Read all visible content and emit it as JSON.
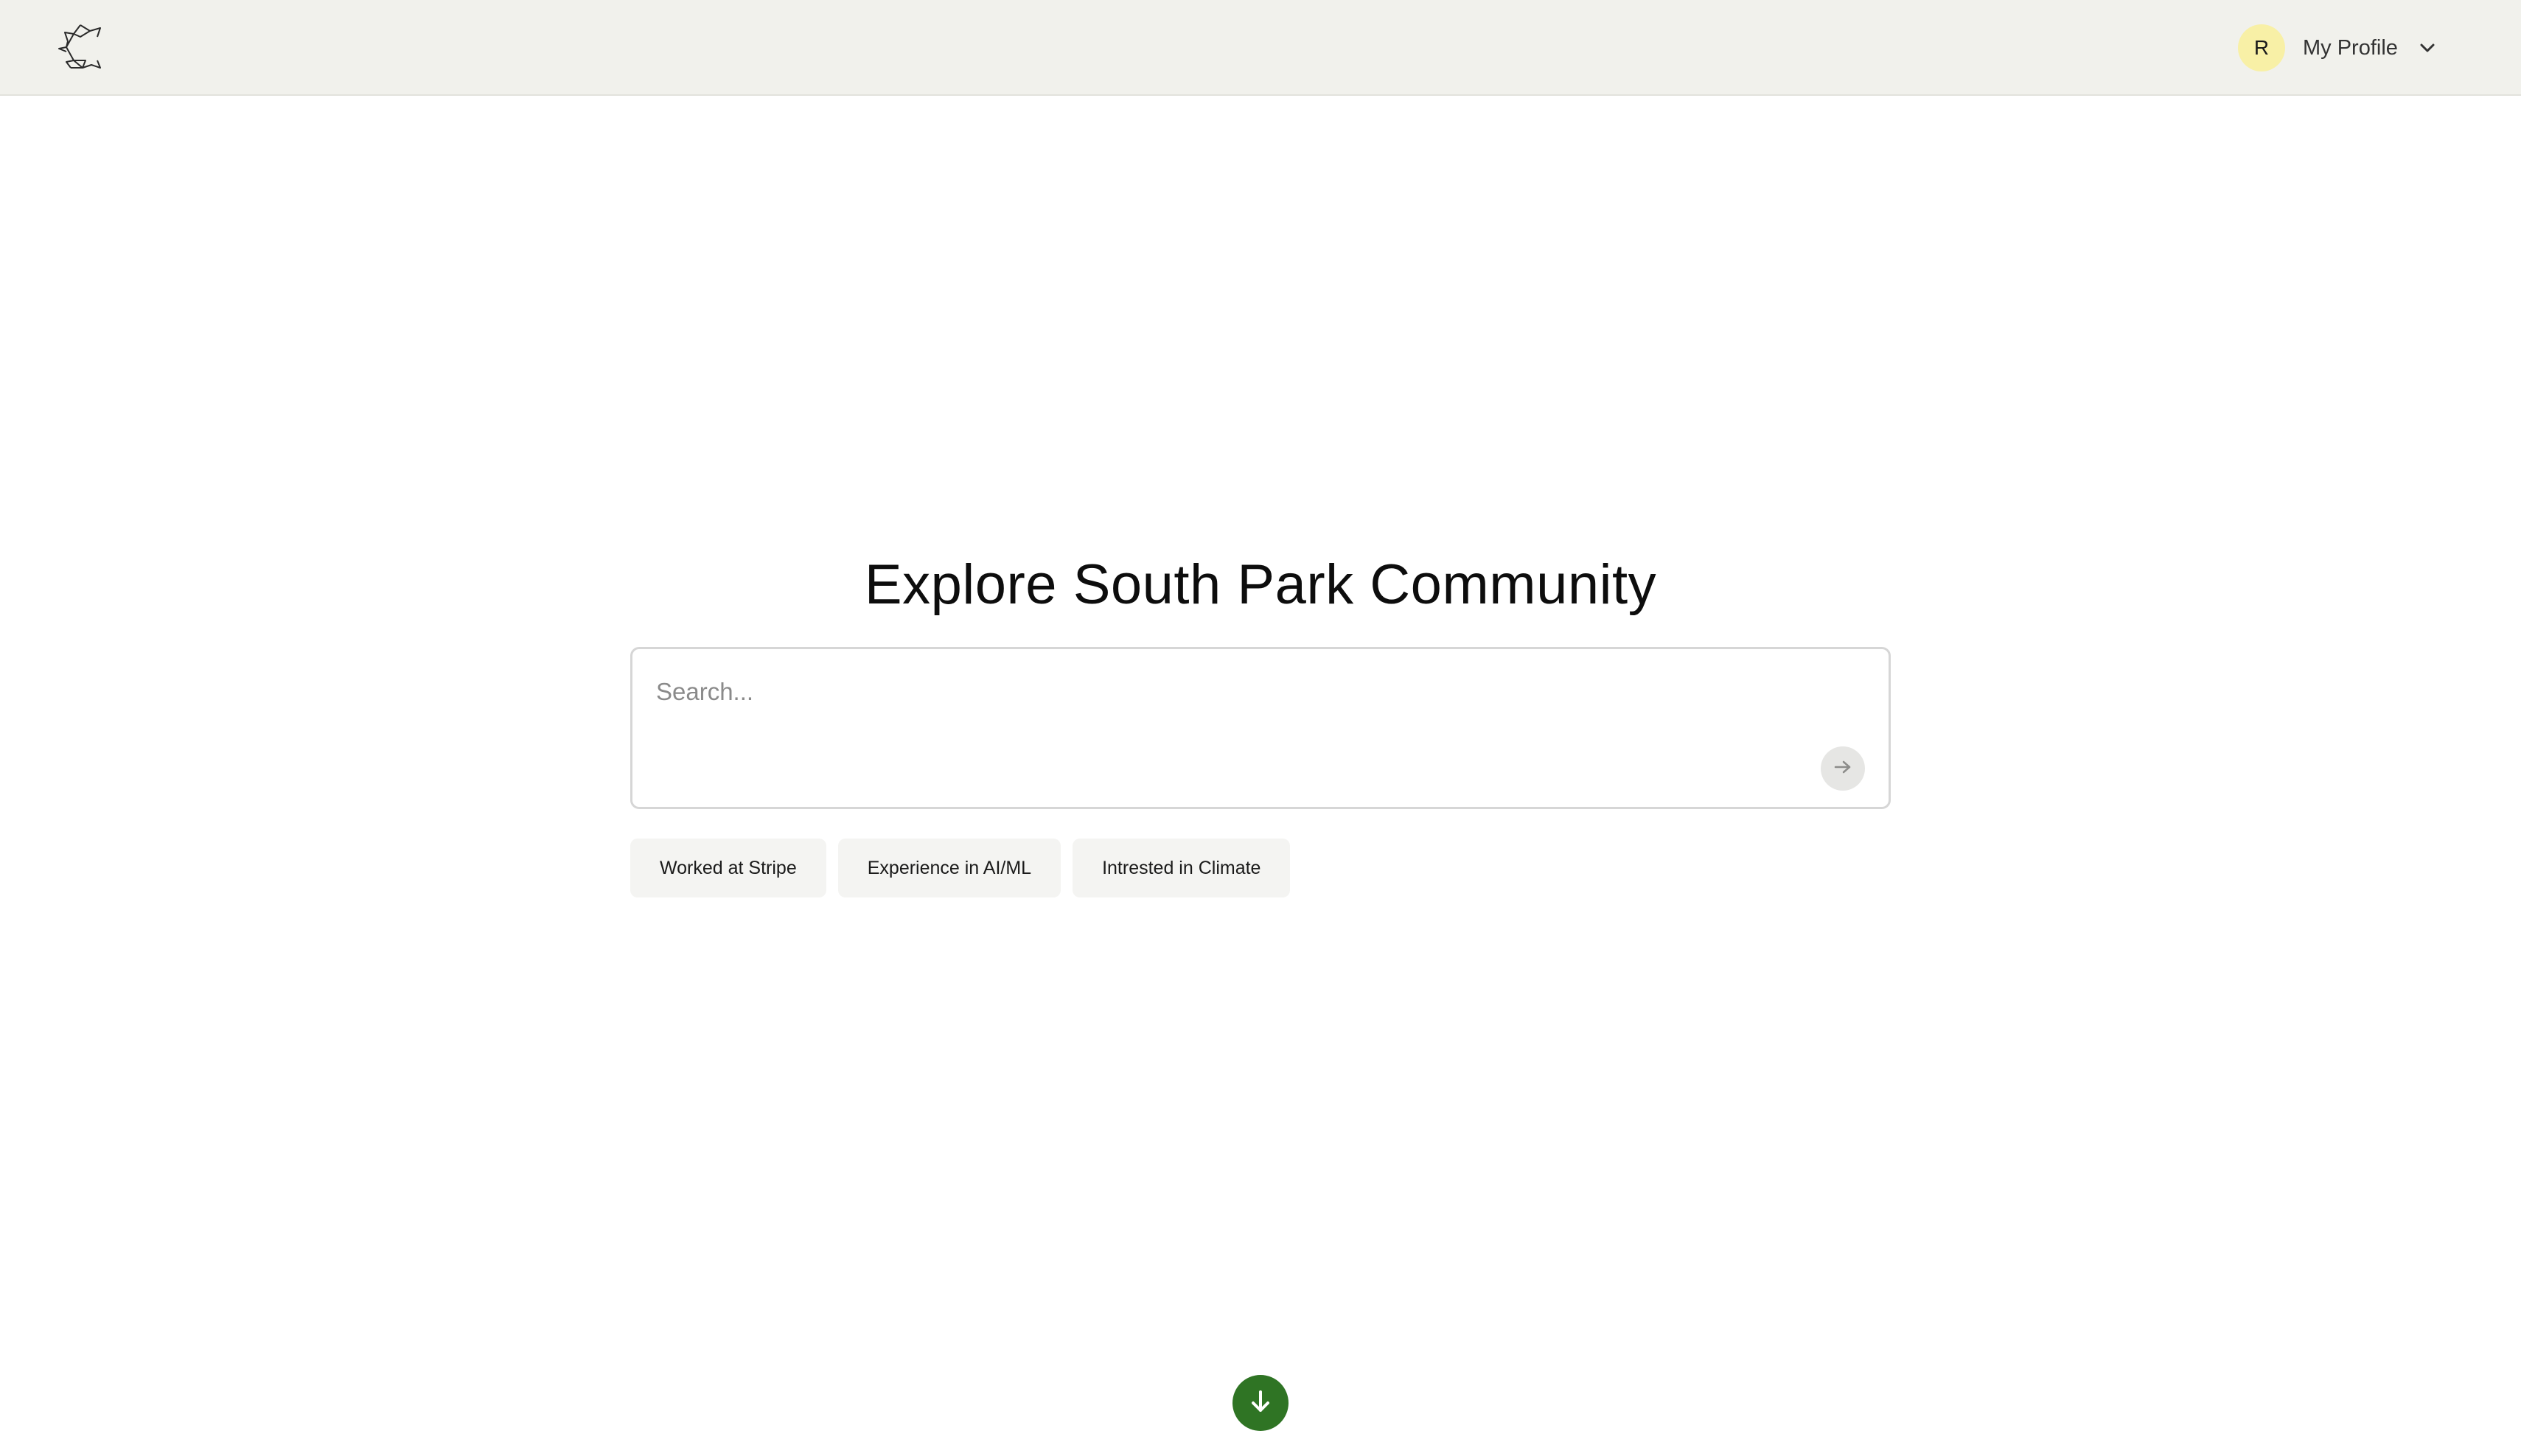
{
  "header": {
    "logo_icon": "community-logo-icon",
    "profile": {
      "avatar_initial": "R",
      "label": "My Profile",
      "dropdown_icon": "chevron-down-icon"
    }
  },
  "main": {
    "title": "Explore South Park Community",
    "search": {
      "placeholder": "Search...",
      "value": "",
      "submit_icon": "arrow-right-icon"
    },
    "suggestions": [
      {
        "label": "Worked at Stripe"
      },
      {
        "label": "Experience in AI/ML"
      },
      {
        "label": "Intrested in Climate"
      }
    ],
    "scroll_icon": "arrow-down-icon"
  },
  "colors": {
    "header_bg": "#f1f1ec",
    "avatar_bg": "#f8f0a6",
    "accent_green": "#2f7424",
    "chip_bg": "#f4f4f2"
  }
}
